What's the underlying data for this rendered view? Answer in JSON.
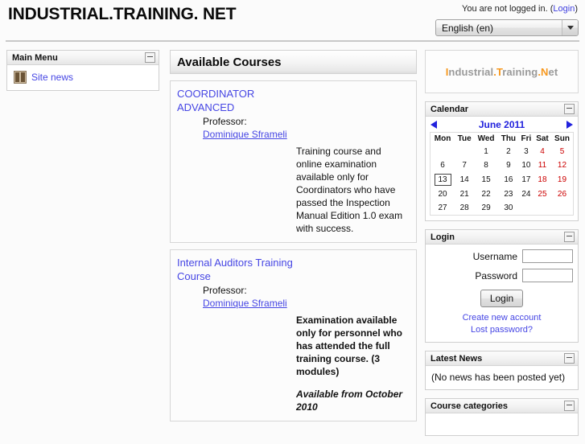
{
  "header": {
    "site_title": "INDUSTRIAL.TRAINING. NET",
    "login_status_text": "You are not logged in. (",
    "login_link": "Login",
    "login_status_close": ")",
    "language_selected": "English (en)",
    "language_options": [
      "English (en)"
    ],
    "dropdown_icon": "chevron-down-icon"
  },
  "sidebar_left": {
    "blocks": [
      {
        "title": "Main Menu",
        "minimize_icon": "minimize-icon",
        "items": [
          {
            "label": "Site news",
            "icon": "forum-news-icon"
          }
        ]
      }
    ]
  },
  "main": {
    "heading": "Available Courses",
    "courses": [
      {
        "title": "COORDINATOR ADVANCED",
        "teacher_role": "Professor:",
        "teacher_name": "Dominique Sframeli",
        "summary": "Training course and online examination available only for Coordinators who have passed the Inspection Manual Edition 1.0 exam with success.",
        "summary_bold": false,
        "availability": ""
      },
      {
        "title": "Internal Auditors Training Course",
        "teacher_role": "Professor:",
        "teacher_name": "Dominique Sframeli",
        "summary": "Examination available only for personnel who has attended the full training course. (3 modules)",
        "summary_bold": true,
        "availability": "Available from October 2010"
      }
    ]
  },
  "sidebar_right": {
    "logo": {
      "parts": [
        {
          "text": "I",
          "color": "orange"
        },
        {
          "text": "ndustrial",
          "color": "gray"
        },
        {
          "text": ".",
          "color": "orange"
        },
        {
          "text": "T",
          "color": "orange"
        },
        {
          "text": "raining",
          "color": "gray"
        },
        {
          "text": ".",
          "color": "orange"
        },
        {
          "text": "N",
          "color": "orange"
        },
        {
          "text": "et",
          "color": "gray"
        }
      ],
      "accent_color": "#f7981d",
      "muted_color": "#9a9a9a"
    },
    "calendar": {
      "title": "Calendar",
      "minimize_icon": "minimize-icon",
      "prev_icon": "prev-month-arrow-icon",
      "next_icon": "next-month-arrow-icon",
      "month_label": "June 2011",
      "weekday_headers": [
        "Mon",
        "Tue",
        "Wed",
        "Thu",
        "Fri",
        "Sat",
        "Sun"
      ],
      "weekend_columns": [
        5,
        6
      ],
      "today": 13,
      "weeks": [
        [
          "",
          "",
          "1",
          "2",
          "3",
          "4",
          "5"
        ],
        [
          "6",
          "7",
          "8",
          "9",
          "10",
          "11",
          "12"
        ],
        [
          "13",
          "14",
          "15",
          "16",
          "17",
          "18",
          "19"
        ],
        [
          "20",
          "21",
          "22",
          "23",
          "24",
          "25",
          "26"
        ],
        [
          "27",
          "28",
          "29",
          "30",
          "",
          "",
          ""
        ]
      ],
      "weekend_color": "#cc0000"
    },
    "login": {
      "title": "Login",
      "minimize_icon": "minimize-icon",
      "username_label": "Username",
      "username_value": "",
      "password_label": "Password",
      "password_value": "",
      "button_label": "Login",
      "create_account_link": "Create new account",
      "lost_password_link": "Lost password?"
    },
    "latest_news": {
      "title": "Latest News",
      "minimize_icon": "minimize-icon",
      "empty_text": "(No news has been posted yet)"
    },
    "course_categories": {
      "title": "Course categories",
      "minimize_icon": "minimize-icon"
    }
  }
}
